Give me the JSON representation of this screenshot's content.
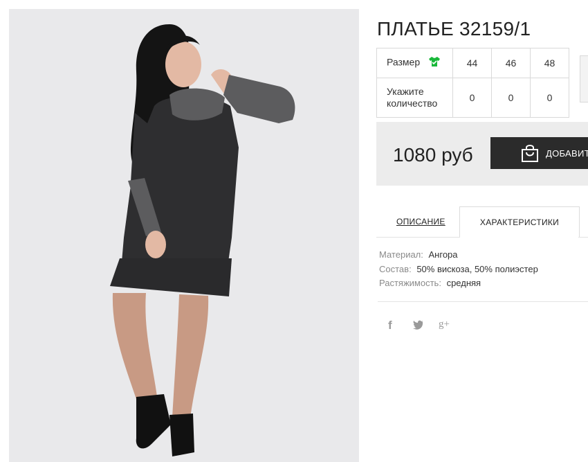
{
  "product": {
    "title": "ПЛАТЬЕ 32159/1",
    "image_alt": "Модель в платье"
  },
  "sizes": {
    "size_label": "Размер",
    "quantity_label": "Укажите количество",
    "columns": [
      {
        "size": "44",
        "qty": "0"
      },
      {
        "size": "46",
        "qty": "0"
      },
      {
        "size": "48",
        "qty": "0"
      }
    ]
  },
  "purchase": {
    "price": "1080 руб",
    "add_label": "ДОБАВИТ"
  },
  "tabs": [
    {
      "label": "ОПИСАНИЕ"
    },
    {
      "label": "ХАРАКТЕРИСТИКИ",
      "active": true
    }
  ],
  "specs": [
    {
      "key": "Материал:",
      "value": "Ангора"
    },
    {
      "key": "Состав:",
      "value": "50% вискоза, 50% полиэстер"
    },
    {
      "key": "Растяжимость:",
      "value": "средняя"
    }
  ],
  "social": {
    "facebook": "f",
    "googleplus": "g+"
  },
  "colors": {
    "button_bg": "#2b2b2b",
    "price_bar_bg": "#ececec",
    "shirt_icon": "#19b83a"
  }
}
